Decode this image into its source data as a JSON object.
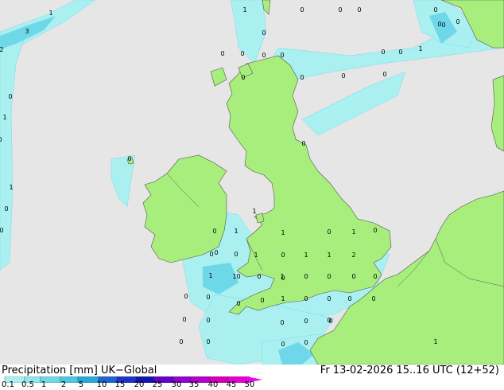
{
  "title": "Precipitation [mm]  UK−Global",
  "datetime": "Fr 13-02-2026 15..16 UTC (12+52)",
  "legend": {
    "ticks": [
      "0.1",
      "0.5",
      "1",
      "2",
      "5",
      "10",
      "15",
      "20",
      "25",
      "30",
      "35",
      "40",
      "45",
      "50"
    ],
    "colors": [
      "#aaf0f0",
      "#8ee6ee",
      "#6ed8e8",
      "#4ec8e0",
      "#2aa8d8",
      "#1e64d2",
      "#1e32c8",
      "#1414b4",
      "#6400c8",
      "#9600d2",
      "#b400c8",
      "#d200b4",
      "#e600d2",
      "#f000f0"
    ]
  },
  "map_labels": {
    "values": [
      "1",
      "3",
      "2",
      "0",
      "1",
      "0",
      "1",
      "0",
      "0",
      "0",
      "0",
      "0",
      "0",
      "0",
      "0",
      "0",
      "0",
      "1",
      "0",
      "0",
      "0",
      "0",
      "0",
      "0",
      "0",
      "0",
      "0",
      "0",
      "0",
      "0",
      "1",
      "1",
      "1",
      "0",
      "0",
      "0",
      "0",
      "1",
      "0",
      "1",
      "1",
      "2",
      "1",
      "1",
      "0",
      "1",
      "0",
      "0",
      "0",
      "0",
      "0",
      "0",
      "1",
      "0",
      "0",
      "0",
      "0",
      "0",
      "0",
      "0",
      "0",
      "0",
      "0",
      "0",
      "1",
      "1",
      "0",
      "0",
      "0",
      "0",
      "0",
      "1",
      "0",
      "0",
      "0",
      "0"
    ]
  }
}
